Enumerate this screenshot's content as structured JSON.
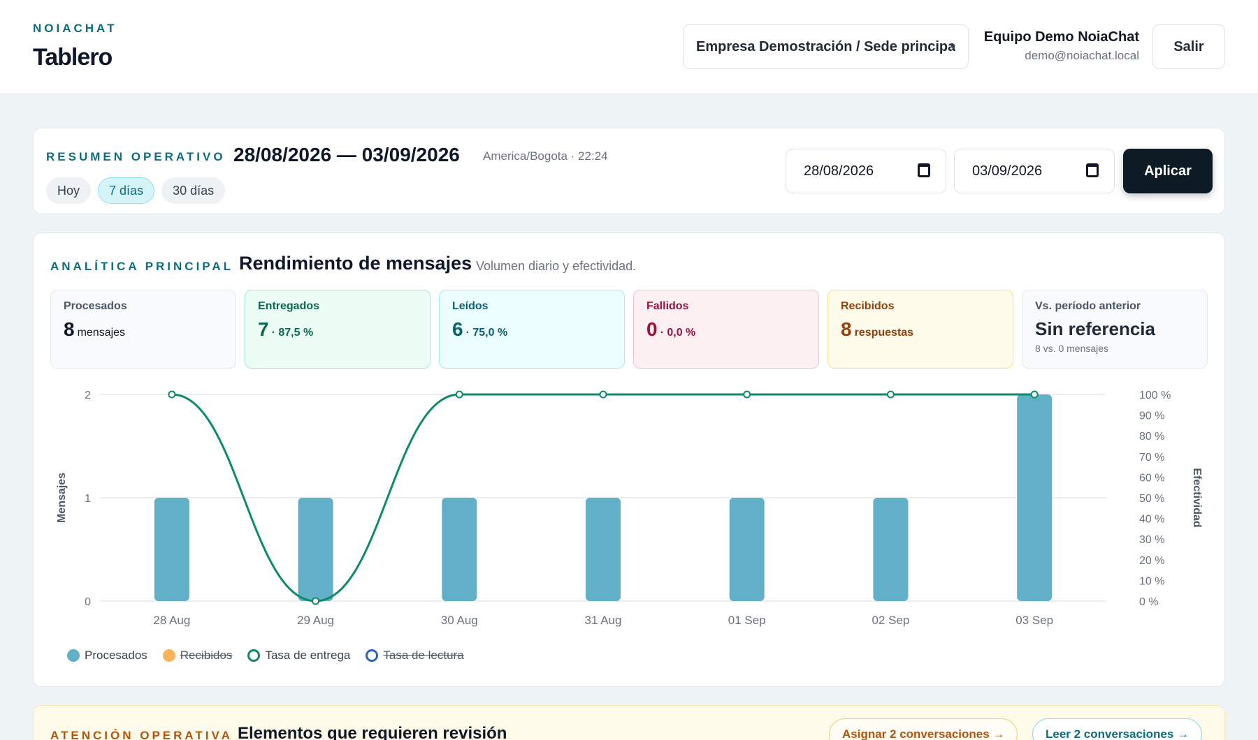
{
  "header": {
    "brand": "NOIACHAT",
    "title": "Tablero",
    "org_select": "Empresa Demostración / Sede principal",
    "user_name": "Equipo Demo NoiaChat",
    "user_email": "demo@noiachat.local",
    "logout": "Salir"
  },
  "summary": {
    "eyebrow": "Resumen operativo",
    "range": "28/08/2026 — 03/09/2026",
    "meta": "America/Bogota · 22:24",
    "quick": [
      "Hoy",
      "7 días",
      "30 días"
    ],
    "active_quick": "7 días",
    "date_from": "28/08/2026",
    "date_to": "03/09/2026",
    "apply": "Aplicar"
  },
  "analytics": {
    "eyebrow": "Analítica principal",
    "title": "Rendimiento de mensajes",
    "subtitle": "Volumen diario y efectividad.",
    "stats": [
      {
        "label": "Procesados",
        "value": "8",
        "suffix": "mensajes"
      },
      {
        "label": "Entregados",
        "value": "7",
        "suffix": "· 87,5 %"
      },
      {
        "label": "Leídos",
        "value": "6",
        "suffix": "· 75,0 %"
      },
      {
        "label": "Fallidos",
        "value": "0",
        "suffix": "· 0,0 %"
      },
      {
        "label": "Recibidos",
        "value": "8",
        "suffix": "respuestas"
      },
      {
        "label": "Vs. período anterior",
        "value": "Sin referencia",
        "note": "8 vs. 0 mensajes"
      }
    ]
  },
  "chart_data": {
    "type": "bar",
    "categories": [
      "28 Aug",
      "29 Aug",
      "30 Aug",
      "31 Aug",
      "01 Sep",
      "02 Sep",
      "03 Sep"
    ],
    "series": [
      {
        "name": "Procesados",
        "type": "bar",
        "axis": "left",
        "values": [
          1,
          1,
          1,
          1,
          1,
          1,
          2
        ],
        "color": "#62afc8"
      },
      {
        "name": "Recibidos",
        "type": "bar",
        "axis": "left",
        "hidden": true,
        "values": [],
        "color": "#f8b35b"
      },
      {
        "name": "Tasa de entrega",
        "type": "line",
        "axis": "right",
        "values": [
          100,
          0,
          100,
          100,
          100,
          100,
          100
        ],
        "color": "#0e8a68"
      },
      {
        "name": "Tasa de lectura",
        "type": "line",
        "axis": "right",
        "hidden": true,
        "values": [],
        "color": "#2b62c9"
      }
    ],
    "ylabel": "Mensajes",
    "y2label": "Efectividad",
    "yticks": [
      "0",
      "1",
      "2"
    ],
    "ylim": [
      0,
      2
    ],
    "y2ticks": [
      "0 %",
      "10 %",
      "20 %",
      "30 %",
      "40 %",
      "50 %",
      "60 %",
      "70 %",
      "80 %",
      "90 %",
      "100 %"
    ],
    "y2lim": [
      0,
      100
    ],
    "grid": true,
    "legend": "bottom-left"
  },
  "attention": {
    "eyebrow": "Atención operativa",
    "title": "Elementos que requieren revisión",
    "assign_btn": "Asignar 2 conversaciones →",
    "read_btn": "Leer 2 conversaciones →"
  }
}
